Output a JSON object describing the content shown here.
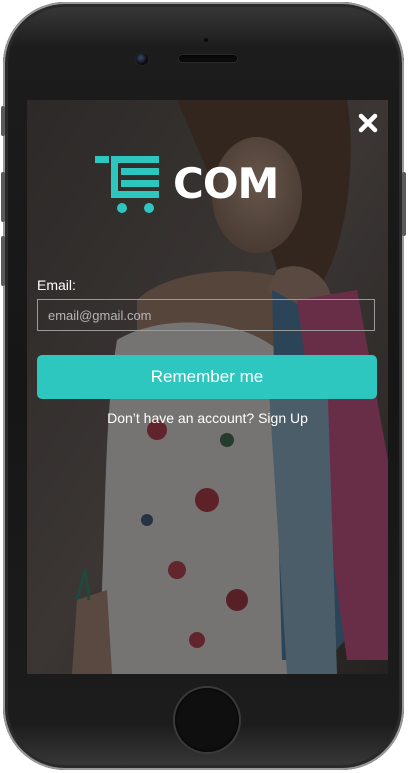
{
  "brand": {
    "name": "COM",
    "accent_color": "#2ec7c0",
    "logo_icon": "cart-icon"
  },
  "close": {
    "icon": "close-icon"
  },
  "form": {
    "email_label": "Email:",
    "email_placeholder": "email@gmail.com",
    "email_value": "",
    "submit_label": "Remember me"
  },
  "signup": {
    "prompt": "Don’t have an account?",
    "link_label": "Sign Up"
  }
}
